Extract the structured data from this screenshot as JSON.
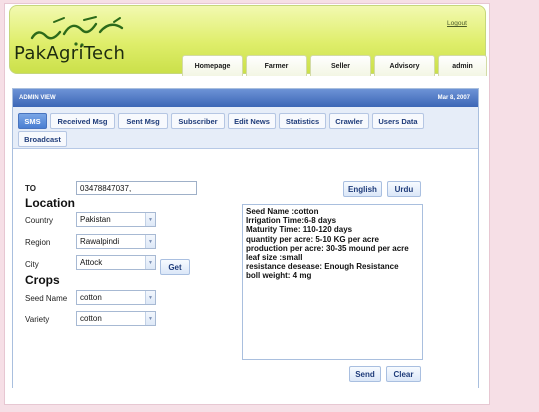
{
  "header": {
    "logo_urdu": "سکھستان",
    "logo_text": "PakAgriTech",
    "logout": "Logout",
    "nav": [
      "Homepage",
      "Farmer",
      "Seller",
      "Advisory",
      "admin"
    ]
  },
  "panel": {
    "title": "ADMIN VIEW",
    "date": "Mar 8, 2007",
    "tabs": [
      "SMS",
      "Received Msg",
      "Sent Msg",
      "Subscriber",
      "Edit News",
      "Statistics",
      "Crawler",
      "Users Data",
      "Broadcast"
    ],
    "active_tab": "SMS"
  },
  "form": {
    "to_label": "TO",
    "to_value": "03478847037,",
    "location_heading": "Location",
    "country_label": "Country",
    "country_value": "Pakistan",
    "region_label": "Region",
    "region_value": "Rawalpindi",
    "city_label": "City",
    "city_value": "Attock",
    "get_button": "Get",
    "crops_heading": "Crops",
    "seed_label": "Seed Name",
    "seed_value": "cotton",
    "variety_label": "Variety",
    "variety_value": "cotton",
    "english_button": "English",
    "urdu_button": "Urdu",
    "message_lines": [
      "Seed Name :cotton",
      "Irrigation Time:6-8 days",
      "Maturity Time: 110-120 days",
      "quantity per acre: 5-10 KG per acre",
      "production per acre: 30-35 mound per acre",
      "leaf size :small",
      "resistance desease: Enough Resistance",
      "boll weight: 4 mg"
    ],
    "send_button": "Send",
    "clear_button": "Clear"
  },
  "colors": {
    "header_green": "#dfee6b",
    "panel_blue": "#3c66b6",
    "tab_active": "#4a7fd2",
    "background_pink": "#f6dfe6"
  }
}
